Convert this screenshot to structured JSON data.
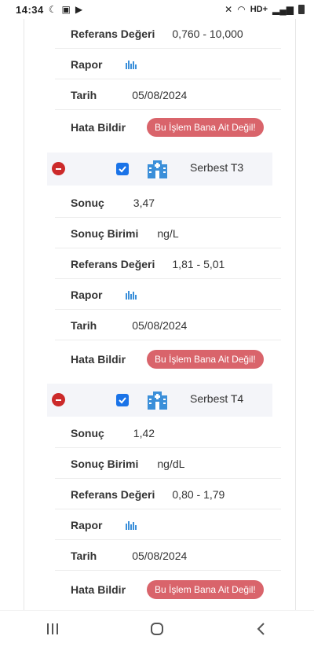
{
  "status_bar": {
    "time": "14:34",
    "left_icons": [
      "moon-icon",
      "gallery-icon",
      "play-icon"
    ],
    "right_text": "HD+",
    "right_icons": [
      "mute-icon",
      "wifi-icon",
      "signal-icon",
      "battery-icon"
    ]
  },
  "error_button_label": "Bu İşlem Bana Ait Değil!",
  "top_partial": {
    "reference_label": "Referans Değeri",
    "reference_value": "0,760 - 10,000",
    "report_label": "Rapor",
    "date_label": "Tarih",
    "date_value": "05/08/2024",
    "error_label": "Hata Bildir"
  },
  "tests": [
    {
      "name": "Serbest T3",
      "checked": true,
      "rows": {
        "result_label": "Sonuç",
        "result_value": "3,47",
        "unit_label": "Sonuç Birimi",
        "unit_value": "ng/L",
        "reference_label": "Referans Değeri",
        "reference_value": "1,81 - 5,01",
        "report_label": "Rapor",
        "date_label": "Tarih",
        "date_value": "05/08/2024",
        "error_label": "Hata Bildir"
      }
    },
    {
      "name": "Serbest T4",
      "checked": true,
      "rows": {
        "result_label": "Sonuç",
        "result_value": "1,42",
        "unit_label": "Sonuç Birimi",
        "unit_value": "ng/dL",
        "reference_label": "Referans Değeri",
        "reference_value": "0,80 - 1,79",
        "report_label": "Rapor",
        "date_label": "Tarih",
        "date_value": "05/08/2024",
        "error_label": "Hata Bildir"
      }
    }
  ],
  "nav_bar": [
    "recents-icon",
    "home-icon",
    "back-icon"
  ],
  "colors": {
    "accent": "#1a73e8",
    "error_button": "#d9646b",
    "minus": "#cc2a2a",
    "icon_blue": "#3b8fd9"
  }
}
